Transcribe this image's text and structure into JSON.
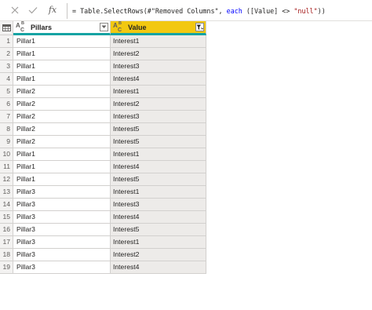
{
  "formula_bar": {
    "fx_label": "fx",
    "formula_prefix": "= Table.SelectRows(#\"Removed Columns\", ",
    "formula_keyword": "each",
    "formula_middle": " ([Value] <> ",
    "formula_string": "\"null\"",
    "formula_suffix": "))"
  },
  "table": {
    "columns": [
      {
        "type_icon": "ABC",
        "label": "Pillars"
      },
      {
        "type_icon": "ABC",
        "label": "Value"
      }
    ],
    "rows": [
      {
        "num": "1",
        "pillar": "Pillar1",
        "value": "Interest1"
      },
      {
        "num": "2",
        "pillar": "Pillar1",
        "value": "Interest2"
      },
      {
        "num": "3",
        "pillar": "Pillar1",
        "value": "Interest3"
      },
      {
        "num": "4",
        "pillar": "Pillar1",
        "value": "Interest4"
      },
      {
        "num": "5",
        "pillar": "Pillar2",
        "value": "Interest1"
      },
      {
        "num": "6",
        "pillar": "Pillar2",
        "value": "Interest2"
      },
      {
        "num": "7",
        "pillar": "Pillar2",
        "value": "Interest3"
      },
      {
        "num": "8",
        "pillar": "Pillar2",
        "value": "Interest5"
      },
      {
        "num": "9",
        "pillar": "Pillar2",
        "value": "Interest5"
      },
      {
        "num": "10",
        "pillar": "Pillar1",
        "value": "Interest1"
      },
      {
        "num": "11",
        "pillar": "Pillar1",
        "value": "Interest4"
      },
      {
        "num": "12",
        "pillar": "Pillar1",
        "value": "Interest5"
      },
      {
        "num": "13",
        "pillar": "Pillar3",
        "value": "Interest1"
      },
      {
        "num": "14",
        "pillar": "Pillar3",
        "value": "Interest3"
      },
      {
        "num": "15",
        "pillar": "Pillar3",
        "value": "Interest4"
      },
      {
        "num": "16",
        "pillar": "Pillar3",
        "value": "Interest5"
      },
      {
        "num": "17",
        "pillar": "Pillar3",
        "value": "Interest1"
      },
      {
        "num": "18",
        "pillar": "Pillar3",
        "value": "Interest2"
      },
      {
        "num": "19",
        "pillar": "Pillar3",
        "value": "Interest4"
      }
    ]
  },
  "colors": {
    "header_accent": "#15a3a3",
    "selected_column_header": "#f2c811",
    "selected_column_cells": "#edebe9"
  },
  "icons": [
    "close-icon",
    "check-icon",
    "fx-icon",
    "table-icon",
    "text-type-icon",
    "dropdown-icon",
    "filter-applied-icon"
  ]
}
